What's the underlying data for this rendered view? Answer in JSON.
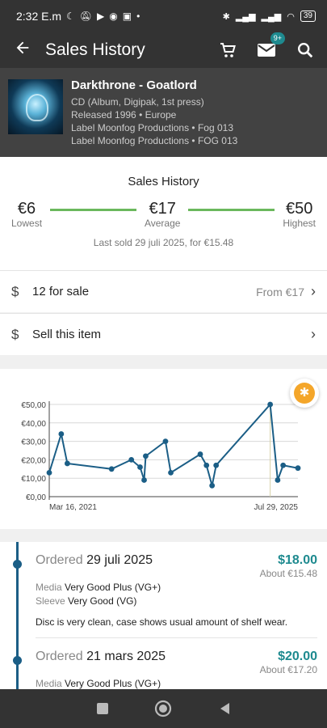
{
  "status": {
    "time": "2:32 E.m",
    "battery": "39"
  },
  "appbar": {
    "title": "Sales History",
    "messages_badge": "9+"
  },
  "release": {
    "title": "Darkthrone - Goatlord",
    "format": "CD (Album, Digipak, 1st press)",
    "released": "Released 1996 • Europe",
    "label1": "Label Moonfog Productions • Fog 013",
    "label2": "Label Moonfog Productions • FOG 013"
  },
  "summary": {
    "title": "Sales History",
    "lowest_value": "€6",
    "lowest_label": "Lowest",
    "average_value": "€17",
    "average_label": "Average",
    "highest_value": "€50",
    "highest_label": "Highest",
    "last_sold": "Last sold 29 juli 2025, for €15.48"
  },
  "for_sale": {
    "label": "12 for sale",
    "from": "From €17"
  },
  "sell": {
    "label": "Sell this item"
  },
  "chart_data": {
    "type": "line",
    "x_tick_labels": [
      "Mar 16, 2021",
      "Jul 29, 2025"
    ],
    "y_tick_labels": [
      "€0,00",
      "€10,00",
      "€20,00",
      "€30,00",
      "€40,00",
      "€50,00"
    ],
    "ylim": [
      0,
      50
    ],
    "grid": true,
    "series": [
      {
        "color": "#1b5e86",
        "x": [
          "2021-03-16",
          "2021-06-01",
          "2021-07-10",
          "2022-04-20",
          "2022-08-25",
          "2022-10-20",
          "2022-11-15",
          "2022-11-25",
          "2023-04-01",
          "2023-05-05",
          "2023-11-10",
          "2023-12-20",
          "2024-01-25",
          "2024-02-20",
          "2025-02-01",
          "2025-03-21",
          "2025-04-25",
          "2025-07-29"
        ],
        "y": [
          13,
          34,
          18,
          15,
          20,
          16,
          9,
          22,
          30,
          13,
          23,
          17,
          6,
          17,
          50,
          9,
          17,
          15.48
        ]
      }
    ]
  },
  "orders": [
    {
      "label": "Ordered",
      "date": "29 juli 2025",
      "price": "$18.00",
      "about": "About €15.48",
      "media_label": "Media",
      "media": "Very Good Plus (VG+)",
      "sleeve_label": "Sleeve",
      "sleeve": "Very Good (VG)",
      "comment": "Disc is very clean, case shows usual amount of shelf wear."
    },
    {
      "label": "Ordered",
      "date": "21 mars 2025",
      "price": "$20.00",
      "about": "About €17.20",
      "media_label": "Media",
      "media": "Very Good Plus (VG+)"
    }
  ]
}
